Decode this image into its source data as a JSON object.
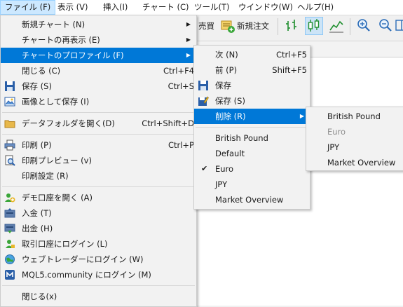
{
  "menubar": {
    "items": [
      {
        "label": "ファイル (F)"
      },
      {
        "label": "表示 (V)"
      },
      {
        "label": "挿入(I)"
      },
      {
        "label": "チャート (C)"
      },
      {
        "label": "ツール(T)"
      },
      {
        "label": "ウインドウ(W)"
      },
      {
        "label": "ヘルプ(H)"
      }
    ]
  },
  "toolbar": {
    "buy_label": "売買",
    "new_order_label": "新規注文"
  },
  "file_menu": {
    "items": [
      {
        "label": "新規チャート (N)",
        "shortcut": "",
        "submenu": true
      },
      {
        "label": "チャートの再表示 (E)",
        "shortcut": "",
        "submenu": true
      },
      {
        "label": "チャートのプロファイル (F)",
        "shortcut": "",
        "submenu": true
      },
      {
        "label": "閉じる (C)",
        "shortcut": "Ctrl+F4"
      },
      {
        "label": "保存 (S)",
        "shortcut": "Ctrl+S"
      },
      {
        "label": "画像として保存 (I)",
        "shortcut": ""
      },
      {
        "label": "データフォルダを開く(D)",
        "shortcut": "Ctrl+Shift+D"
      },
      {
        "label": "印刷 (P)",
        "shortcut": "Ctrl+P"
      },
      {
        "label": "印刷プレビュー (v)",
        "shortcut": ""
      },
      {
        "label": "印刷設定 (R)",
        "shortcut": ""
      },
      {
        "label": "デモ口座を開く (A)",
        "shortcut": ""
      },
      {
        "label": "入金 (T)",
        "shortcut": ""
      },
      {
        "label": "出金 (H)",
        "shortcut": ""
      },
      {
        "label": "取引口座にログイン (L)",
        "shortcut": ""
      },
      {
        "label": "ウェブトレーダーにログイン (W)",
        "shortcut": ""
      },
      {
        "label": "MQL5.community にログイン (M)",
        "shortcut": ""
      },
      {
        "label": "閉じる(x)",
        "shortcut": ""
      }
    ]
  },
  "profiles_menu": {
    "items": [
      {
        "label": "次 (N)",
        "shortcut": "Ctrl+F5"
      },
      {
        "label": "前 (P)",
        "shortcut": "Shift+F5"
      },
      {
        "label": "保存",
        "shortcut": ""
      },
      {
        "label": "保存 (S)",
        "shortcut": ""
      },
      {
        "label": "削除 (R)",
        "shortcut": "",
        "submenu": true
      }
    ],
    "profiles": [
      {
        "label": "British Pound",
        "checked": false
      },
      {
        "label": "Default",
        "checked": false
      },
      {
        "label": "Euro",
        "checked": true
      },
      {
        "label": "JPY",
        "checked": false
      },
      {
        "label": "Market Overview",
        "checked": false
      }
    ]
  },
  "delete_menu": {
    "items": [
      {
        "label": "British Pound",
        "disabled": false
      },
      {
        "label": "Euro",
        "disabled": true
      },
      {
        "label": "JPY",
        "disabled": false
      },
      {
        "label": "Market Overview",
        "disabled": false
      }
    ]
  },
  "colors": {
    "highlight": "#0078d7",
    "menubar_open": "#cce8ff"
  }
}
